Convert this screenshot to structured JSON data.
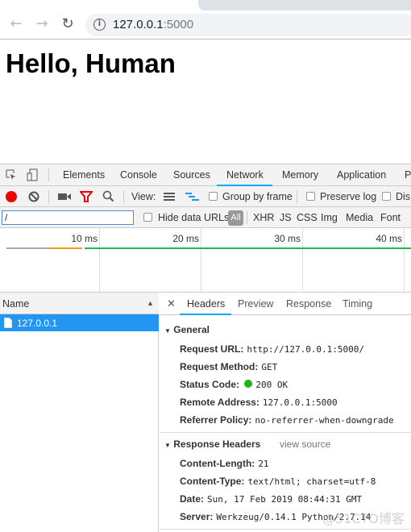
{
  "browser": {
    "url_host": "127.0.0.1",
    "url_port": ":5000"
  },
  "page": {
    "heading": "Hello, Human"
  },
  "devtools": {
    "tabs": [
      "Elements",
      "Console",
      "Sources",
      "Network",
      "Memory",
      "Application",
      "P"
    ],
    "active_tab": "Network",
    "toolbar": {
      "view_label": "View:",
      "group_by_frame": "Group by frame",
      "preserve_log": "Preserve log",
      "disable_cache": "Dis"
    },
    "filter": {
      "value": "/",
      "hide_data_urls": "Hide data URLs",
      "types": [
        "All",
        "XHR",
        "JS",
        "CSS",
        "Img",
        "Media",
        "Font"
      ]
    },
    "timeline": {
      "ticks": [
        "10 ms",
        "20 ms",
        "30 ms",
        "40 ms"
      ]
    },
    "requests": {
      "name_header": "Name",
      "items": [
        {
          "name": "127.0.0.1",
          "selected": true
        }
      ]
    },
    "detail_tabs": [
      "Headers",
      "Preview",
      "Response",
      "Timing"
    ],
    "active_detail_tab": "Headers",
    "general": {
      "title": "General",
      "rows": [
        {
          "k": "Request URL:",
          "v": "http://127.0.0.1:5000/"
        },
        {
          "k": "Request Method:",
          "v": "GET"
        },
        {
          "k": "Status Code:",
          "v": "200 OK"
        },
        {
          "k": "Remote Address:",
          "v": "127.0.0.1:5000"
        },
        {
          "k": "Referrer Policy:",
          "v": "no-referrer-when-downgrade"
        }
      ]
    },
    "response_headers": {
      "title": "Response Headers",
      "view_source": "view source",
      "rows": [
        {
          "k": "Content-Length:",
          "v": "21"
        },
        {
          "k": "Content-Type:",
          "v": "text/html; charset=utf-8"
        },
        {
          "k": "Date:",
          "v": "Sun, 17 Feb 2019 08:44:31 GMT"
        },
        {
          "k": "Server:",
          "v": "Werkzeug/0.14.1 Python/2.7.14"
        }
      ]
    }
  },
  "colors": {
    "accent": "#03a9f4",
    "record": "#e00",
    "filter": "#e00",
    "selected": "#2196f3",
    "status_ok": "#1db41d"
  },
  "watermark": "@51CTO博客"
}
